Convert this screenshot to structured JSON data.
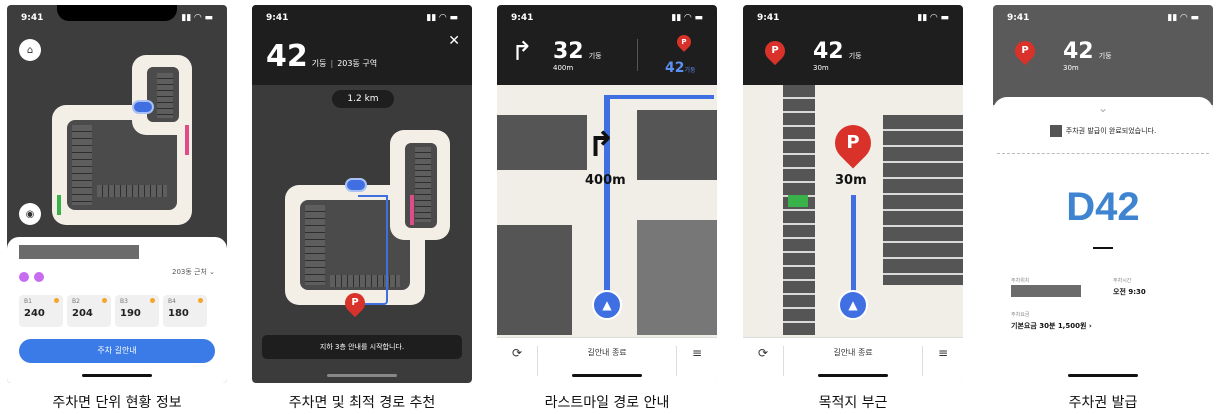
{
  "status_time": "9:41",
  "captions": [
    "주차면 단위 현황 정보",
    "주차면 및 최적 경로 추천",
    "라스트마일 경로 안내",
    "목적지 부근",
    "주차권 발급"
  ],
  "screen1": {
    "near_label": "203동 근처",
    "floors": [
      {
        "name": "B1",
        "count": "240"
      },
      {
        "name": "B2",
        "count": "204"
      },
      {
        "name": "B3",
        "count": "190"
      },
      {
        "name": "B4",
        "count": "180"
      }
    ],
    "cta": "주차 길안내"
  },
  "screen2": {
    "slot_number": "42",
    "slot_unit": "기둥",
    "zone": "203동 구역",
    "distance": "1.2 km",
    "toast": "지하 3층 안내를 시작합니다."
  },
  "screen3": {
    "next_pillar": "32",
    "next_unit": "기둥",
    "next_distance": "400m",
    "dest_pillar": "42",
    "dest_unit": "기둥",
    "map_distance": "400m",
    "end_label": "길안내 종료"
  },
  "screen4": {
    "pillar": "42",
    "unit": "기둥",
    "distance": "30m",
    "map_distance": "30m",
    "end_label": "길안내 종료"
  },
  "screen5": {
    "pillar": "42",
    "unit": "기둥",
    "distance": "30m",
    "issued_msg": "주차권 발급이 완료되었습니다.",
    "spot": "D42",
    "location_label": "주차위치",
    "time_label": "주차시간",
    "time_value": "오전 9:30",
    "fee_label": "주차요금",
    "fee_value": "기본요금 30분 1,500원"
  }
}
